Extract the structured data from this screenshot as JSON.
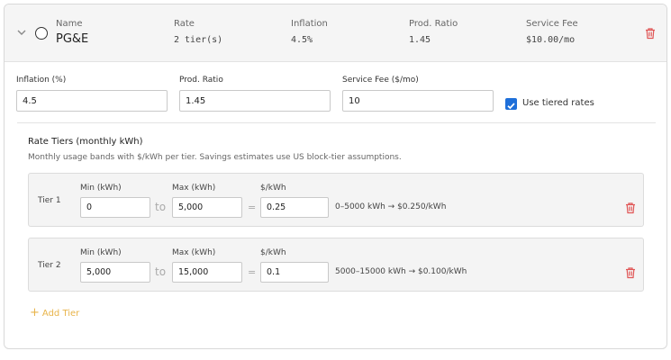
{
  "header": {
    "name_label": "Name",
    "name_value": "PG&E",
    "rate_label": "Rate",
    "rate_value": "2 tier(s)",
    "inflation_label": "Inflation",
    "inflation_value": "4.5%",
    "ratio_label": "Prod. Ratio",
    "ratio_value": "1.45",
    "fee_label": "Service Fee",
    "fee_value": "$10.00/mo"
  },
  "form": {
    "inflation_label": "Inflation (%)",
    "inflation_value": "4.5",
    "ratio_label": "Prod. Ratio",
    "ratio_value": "1.45",
    "fee_label": "Service Fee ($/mo)",
    "fee_value": "10",
    "tiered_label": "Use tiered rates",
    "tiered_checked": true
  },
  "tiers_section": {
    "title": "Rate Tiers (monthly kWh)",
    "description": "Monthly usage bands with $/kWh per tier. Savings estimates use US block-tier assumptions.",
    "min_label": "Min (kWh)",
    "max_label": "Max (kWh)",
    "rate_label": "$/kWh",
    "to_text": "to",
    "eq_text": "=",
    "add_label": "Add Tier",
    "tiers": [
      {
        "label": "Tier 1",
        "min": "0",
        "max": "5,000",
        "rate": "0.25",
        "summary": "0–5000 kWh → $0.250/kWh"
      },
      {
        "label": "Tier 2",
        "min": "5,000",
        "max": "15,000",
        "rate": "0.1",
        "summary": "5000–15000 kWh → $0.100/kWh"
      }
    ]
  },
  "colors": {
    "accent": "#1e6fd9",
    "delete": "#e05555",
    "add": "#e8b44a"
  }
}
